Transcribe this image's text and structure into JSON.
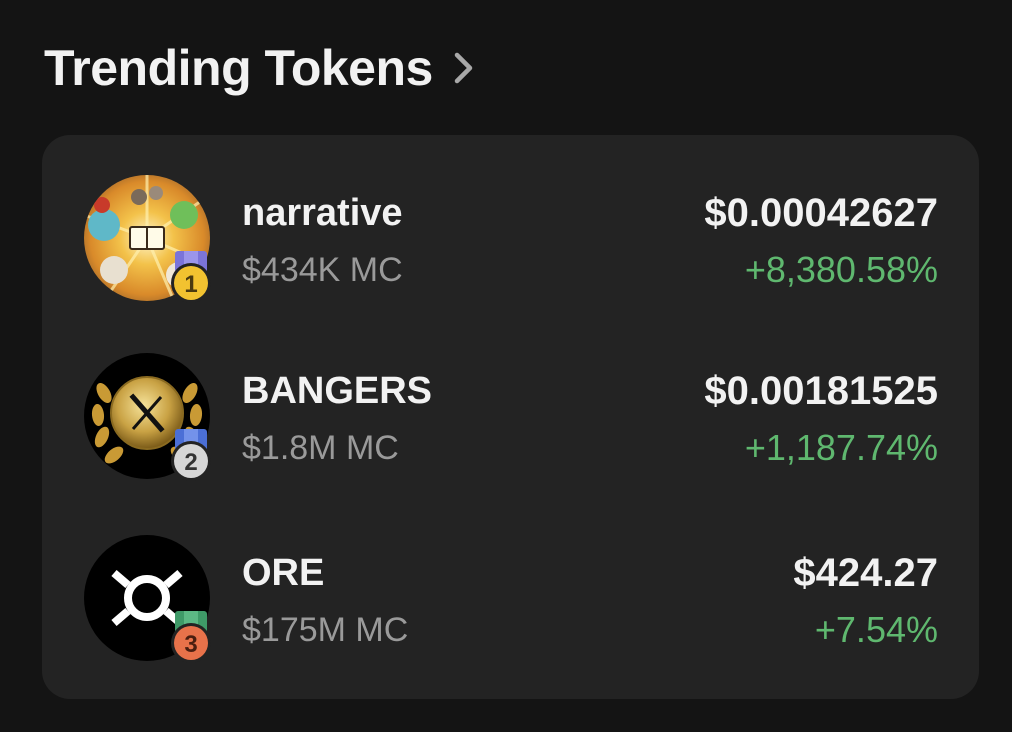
{
  "header": {
    "title": "Trending Tokens",
    "chevron_icon": "chevron-right-icon"
  },
  "colors": {
    "background": "#141414",
    "card": "#232323",
    "positive": "#5fb86f",
    "primary_text": "#f2f2f2",
    "secondary_text": "#9a9a9a"
  },
  "tokens": [
    {
      "rank": "1",
      "name": "narrative",
      "market_cap": "$434K MC",
      "price": "$0.00042627",
      "change": "+8,380.58%",
      "avatar_icon": "narrative-token-avatar",
      "badge_icon": "gold-medal-icon"
    },
    {
      "rank": "2",
      "name": "BANGERS",
      "market_cap": "$1.8M MC",
      "price": "$0.00181525",
      "change": "+1,187.74%",
      "avatar_icon": "bangers-token-avatar",
      "badge_icon": "silver-medal-icon"
    },
    {
      "rank": "3",
      "name": "ORE",
      "market_cap": "$175M MC",
      "price": "$424.27",
      "change": "+7.54%",
      "avatar_icon": "ore-token-avatar",
      "badge_icon": "bronze-medal-icon"
    }
  ]
}
